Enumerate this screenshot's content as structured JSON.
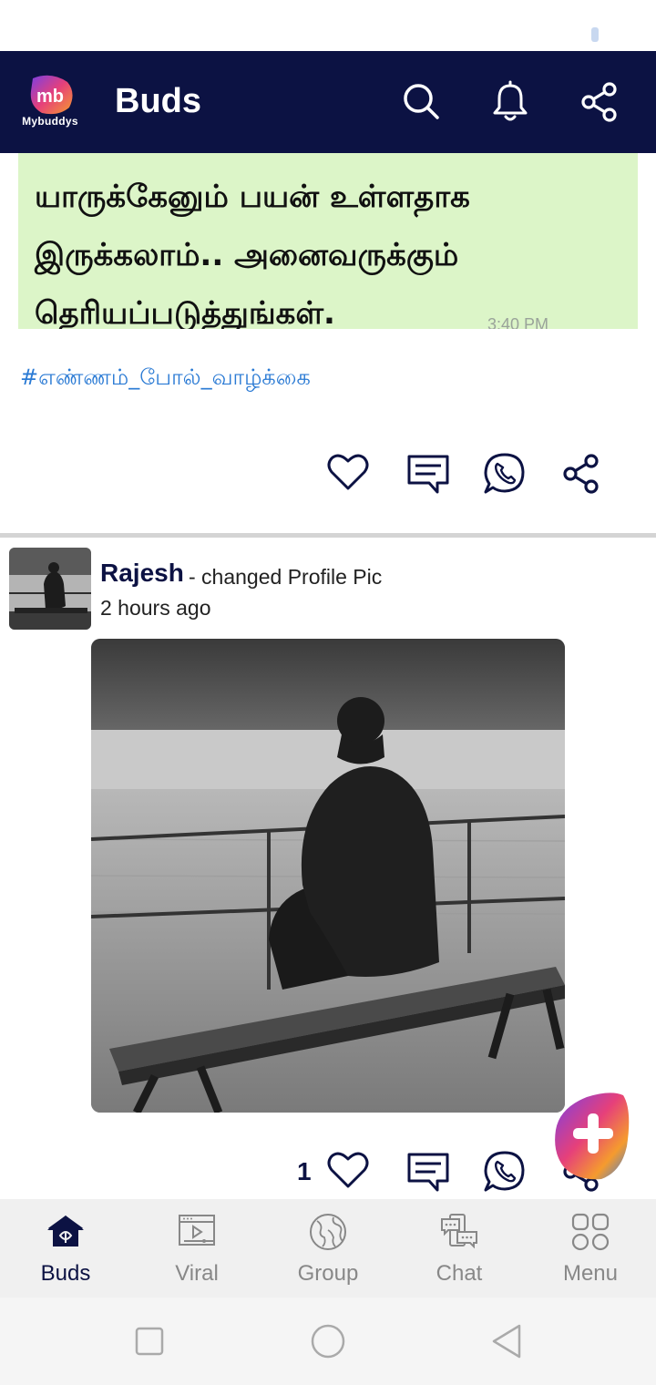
{
  "app": {
    "title": "Buds",
    "logo_initials": "mb",
    "logo_text": "Mybuddys",
    "colors": {
      "header_bg": "#0c1243",
      "accent": "#2a7ad4",
      "quote_bg": "#dcf5c8"
    }
  },
  "header_icons": [
    "search-icon",
    "bell-icon",
    "share-icon"
  ],
  "previous_post": {
    "quote_lines": [
      "யாருக்கேனும் பயன் உள்ளதாக",
      "இருக்கலாம்.. அனைவருக்கும்",
      "தெரியப்படுத்துங்கள்."
    ],
    "quote_timestamp": "3:40 PM",
    "hashtag": "#எண்ணம்_போல்_வாழ்க்கை",
    "actions": [
      "heart-icon",
      "comment-icon",
      "whatsapp-icon",
      "share-icon"
    ]
  },
  "post": {
    "author": "Rajesh",
    "action_text": " - changed Profile Pic",
    "time": "2 hours ago",
    "image_alt": "Man sitting on a bench by a misty lake",
    "like_count": "1",
    "actions": [
      "heart-icon",
      "comment-icon",
      "whatsapp-icon",
      "share-icon"
    ]
  },
  "bottom_nav": [
    {
      "label": "Buds",
      "icon": "home-icon",
      "active": true
    },
    {
      "label": "Viral",
      "icon": "video-icon",
      "active": false
    },
    {
      "label": "Group",
      "icon": "globe-icon",
      "active": false
    },
    {
      "label": "Chat",
      "icon": "chat-icon",
      "active": false
    },
    {
      "label": "Menu",
      "icon": "grid-icon",
      "active": false
    }
  ],
  "system_nav": [
    "recents-button",
    "home-button",
    "back-button"
  ]
}
